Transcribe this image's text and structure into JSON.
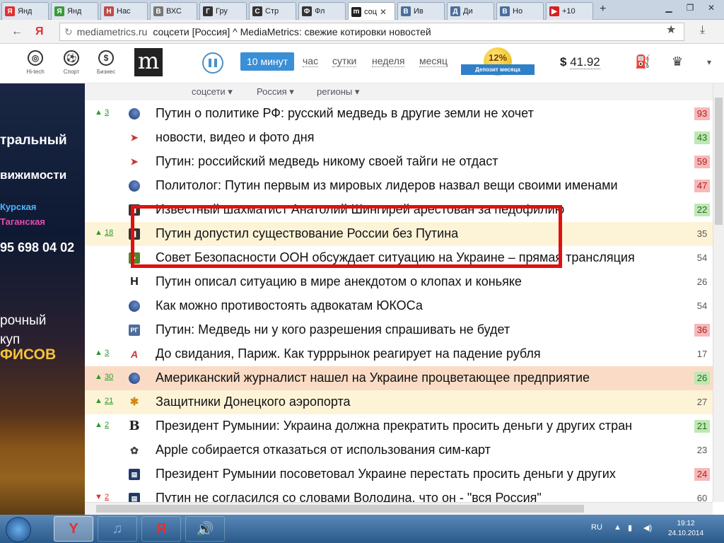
{
  "browser": {
    "tabs": [
      {
        "label": "Янд",
        "favicon": "Я",
        "color": "#e03030"
      },
      {
        "label": "Янд",
        "favicon": "Я",
        "color": "#3a9a3a"
      },
      {
        "label": "Нас",
        "favicon": "Н",
        "color": "#c04a4a"
      },
      {
        "label": "ВХС",
        "favicon": "В",
        "color": "#777777"
      },
      {
        "label": "Гру",
        "favicon": "Г",
        "color": "#333333"
      },
      {
        "label": "Стр",
        "favicon": "С",
        "color": "#333333"
      },
      {
        "label": "Фл",
        "favicon": "Ф",
        "color": "#333333"
      },
      {
        "label": "соц",
        "favicon": "m",
        "color": "#222222",
        "active": true
      },
      {
        "label": "Ив",
        "favicon": "В",
        "color": "#4a6e9e"
      },
      {
        "label": "Ди",
        "favicon": "Д",
        "color": "#4a6e9e"
      },
      {
        "label": "Но",
        "favicon": "В",
        "color": "#4a6e9e"
      },
      {
        "label": "+10",
        "favicon": "▶",
        "color": "#d62020"
      }
    ],
    "new_tab": "+",
    "address": {
      "prefix": "Я",
      "domain": "mediametrics.ru",
      "title": "соцсети [Россия] ^ MediaMetrics: свежие котировки новостей"
    }
  },
  "site": {
    "categories": [
      {
        "label": "Hi-tech",
        "icon": "chrome-icon",
        "glyph": "◎"
      },
      {
        "label": "Спорт",
        "icon": "ball-icon",
        "glyph": "⚽"
      },
      {
        "label": "Бизнес",
        "icon": "dollar-icon",
        "glyph": "$"
      }
    ],
    "logo": "m",
    "periods": [
      "10 минут",
      "час",
      "сутки",
      "неделя",
      "месяц"
    ],
    "deposit": {
      "percent": "12%",
      "label": "Депозит месяца"
    },
    "price": {
      "currency": "$",
      "value": "41.92"
    },
    "filters": [
      "соцсети ▾",
      "Россия ▾",
      "регионы ▾"
    ]
  },
  "banner": {
    "lines": [
      "тральный",
      "вижимости",
      "Курская",
      "Таганская",
      "95 698 04 02",
      "рочный",
      "куп",
      "ФИСОВ"
    ]
  },
  "news": [
    {
      "change": "3",
      "dir": "up",
      "src": "globe",
      "title": "Путин о политике РФ: русский медведь в другие земли не хочет",
      "score": "93",
      "score_color": "red"
    },
    {
      "change": "",
      "dir": "",
      "src": "bird",
      "title": "новости, видео и фото дня",
      "score": "43",
      "score_color": "green"
    },
    {
      "change": "",
      "dir": "",
      "src": "bird",
      "title": "Путин: российский медведь никому своей тайги не отдаст",
      "score": "59",
      "score_color": "red"
    },
    {
      "change": "",
      "dir": "",
      "src": "globe",
      "title": "Политолог: Путин первым из мировых лидеров назвал вещи своими именами",
      "score": "47",
      "score_color": "red"
    },
    {
      "change": "",
      "dir": "",
      "src": "sq",
      "title": "Известный шахматист Анатолий Шингирей арестован за педофилию",
      "score": "22",
      "score_color": "green"
    },
    {
      "change": "18",
      "dir": "up",
      "src": "sq",
      "title": "Путин допустил существование России без Путина",
      "score": "35",
      "score_color": "",
      "hl": "hl1"
    },
    {
      "change": "",
      "dir": "",
      "src": "green",
      "title": "Совет Безопасности ООН обсуждает ситуацию на Украине – прямая трансляция",
      "score": "54",
      "score_color": ""
    },
    {
      "change": "",
      "dir": "",
      "src": "nn",
      "title": "Путин описал ситуацию в мире анекдотом о клопах и коньяке",
      "score": "26",
      "score_color": ""
    },
    {
      "change": "",
      "dir": "",
      "src": "globe",
      "title": "Как можно противостоять адвокатам ЮКОСа",
      "score": "54",
      "score_color": ""
    },
    {
      "change": "",
      "dir": "",
      "src": "rg",
      "title": "Путин: Медведь ни у кого разрешения спрашивать не будет",
      "score": "36",
      "score_color": "red"
    },
    {
      "change": "3",
      "dir": "up",
      "src": "aa",
      "title": "До свидания, Париж. Как турррынок реагирует на падение рубля",
      "score": "17",
      "score_color": ""
    },
    {
      "change": "30",
      "dir": "up",
      "src": "globe",
      "title": "Американский журналист нашел на Украине процветающее предприятие",
      "score": "26",
      "score_color": "green",
      "hl": "hl2"
    },
    {
      "change": "21",
      "dir": "up",
      "src": "star",
      "title": "Защитники Донецкого аэропорта",
      "score": "27",
      "score_color": "",
      "hl": "hl1"
    },
    {
      "change": "2",
      "dir": "up",
      "src": "bb",
      "title": "Президент Румынии: Украина должна прекратить просить деньги у других стран",
      "score": "21",
      "score_color": "green"
    },
    {
      "change": "",
      "dir": "",
      "src": "gear",
      "title": "Apple собирается отказаться от использования сим-карт",
      "score": "23",
      "score_color": ""
    },
    {
      "change": "",
      "dir": "",
      "src": "doc",
      "title": "Президент Румынии посоветовал Украине перестать просить деньги у других",
      "score": "24",
      "score_color": "red"
    },
    {
      "change": "2",
      "dir": "dn",
      "src": "doc",
      "title": "Путин не согласился со словами Володина, что он - \"вся Россия\"",
      "score": "60",
      "score_color": ""
    }
  ],
  "taskbar": {
    "lang": "RU",
    "time": "19:12",
    "date": "24.10.2014"
  }
}
